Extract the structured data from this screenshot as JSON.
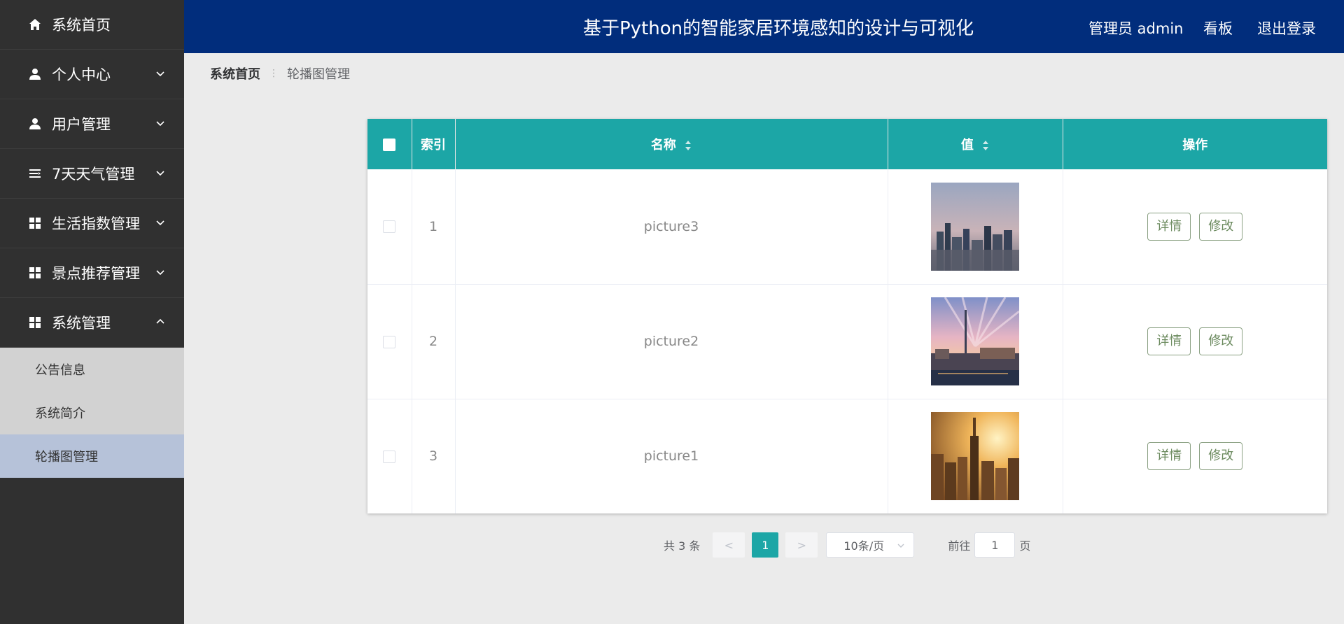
{
  "header": {
    "title": "基于Python的智能家居环境感知的设计与可视化",
    "admin": "管理员 admin",
    "board": "看板",
    "logout": "退出登录"
  },
  "sidebar": {
    "items": [
      {
        "label": "系统首页",
        "icon": "home-icon"
      },
      {
        "label": "个人中心",
        "icon": "user-icon"
      },
      {
        "label": "用户管理",
        "icon": "user-icon"
      },
      {
        "label": "7天天气管理",
        "icon": "list-icon"
      },
      {
        "label": "生活指数管理",
        "icon": "grid-icon"
      },
      {
        "label": "景点推荐管理",
        "icon": "grid-icon"
      },
      {
        "label": "系统管理",
        "icon": "grid-icon"
      }
    ],
    "submenu": [
      {
        "label": "公告信息"
      },
      {
        "label": "系统简介"
      },
      {
        "label": "轮播图管理"
      }
    ]
  },
  "breadcrumb": {
    "home": "系统首页",
    "separator": "⋮",
    "current": "轮播图管理"
  },
  "table": {
    "headers": [
      "索引",
      "名称",
      "值",
      "操作"
    ],
    "rows": [
      {
        "index": "1",
        "name": "picture3"
      },
      {
        "index": "2",
        "name": "picture2"
      },
      {
        "index": "3",
        "name": "picture1"
      }
    ],
    "detail_label": "详情",
    "edit_label": "修改"
  },
  "pager": {
    "total": "共 3 条",
    "prev": "<",
    "next": ">",
    "current": "1",
    "page_size": "10条/页",
    "goto": "前往",
    "goto_value": "1",
    "page_unit": "页"
  },
  "colors": {
    "header_bg": "#012d7c",
    "sidebar_bg": "#303030",
    "table_header_bg": "#1ca6a6",
    "active_sub": "#b6c2d9"
  }
}
